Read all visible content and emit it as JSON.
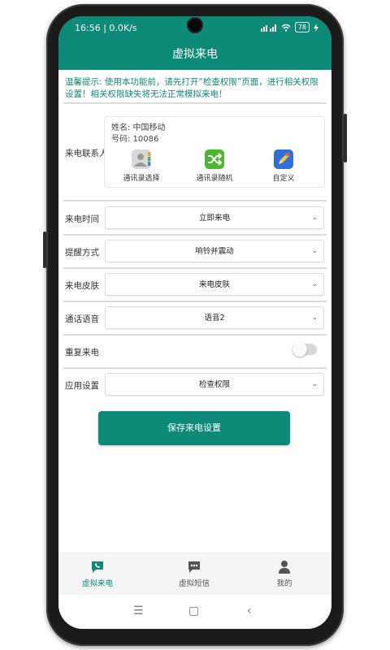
{
  "status": {
    "time_speed": "16:56 | 0.0K/s",
    "battery": "78"
  },
  "header": {
    "title": "虚拟来电"
  },
  "tip": "温馨提示: 使用本功能前，请先打开“检查权限”页面，进行相关权限设置！相关权限缺失将无法正常模拟来电！",
  "contact": {
    "label": "来电联系人",
    "name": "姓名: 中国移动",
    "number": "号码: 10086",
    "buttons": [
      {
        "label": "通讯录选择",
        "icon": "contacts-icon"
      },
      {
        "label": "通讯录随机",
        "icon": "shuffle-icon"
      },
      {
        "label": "自定义",
        "icon": "pencil-icon"
      }
    ]
  },
  "settings": {
    "call_time": {
      "label": "来电时间",
      "value": "立即来电"
    },
    "remind": {
      "label": "提醒方式",
      "value": "响铃并震动"
    },
    "skin": {
      "label": "来电皮肤",
      "value": "来电皮肤"
    },
    "voice": {
      "label": "通话语音",
      "value": "语音2"
    },
    "repeat": {
      "label": "重复来电",
      "on": false
    },
    "app_settings": {
      "label": "应用设置",
      "value": "检查权限"
    }
  },
  "save_button": "保存来电设置",
  "nav": [
    {
      "label": "虚拟来电",
      "icon": "phone-chat-icon",
      "active": true
    },
    {
      "label": "虚拟短信",
      "icon": "sms-icon",
      "active": false
    },
    {
      "label": "我的",
      "icon": "person-icon",
      "active": false
    }
  ],
  "colors": {
    "primary": "#0e8a78",
    "divider": "#dcdcdc"
  }
}
